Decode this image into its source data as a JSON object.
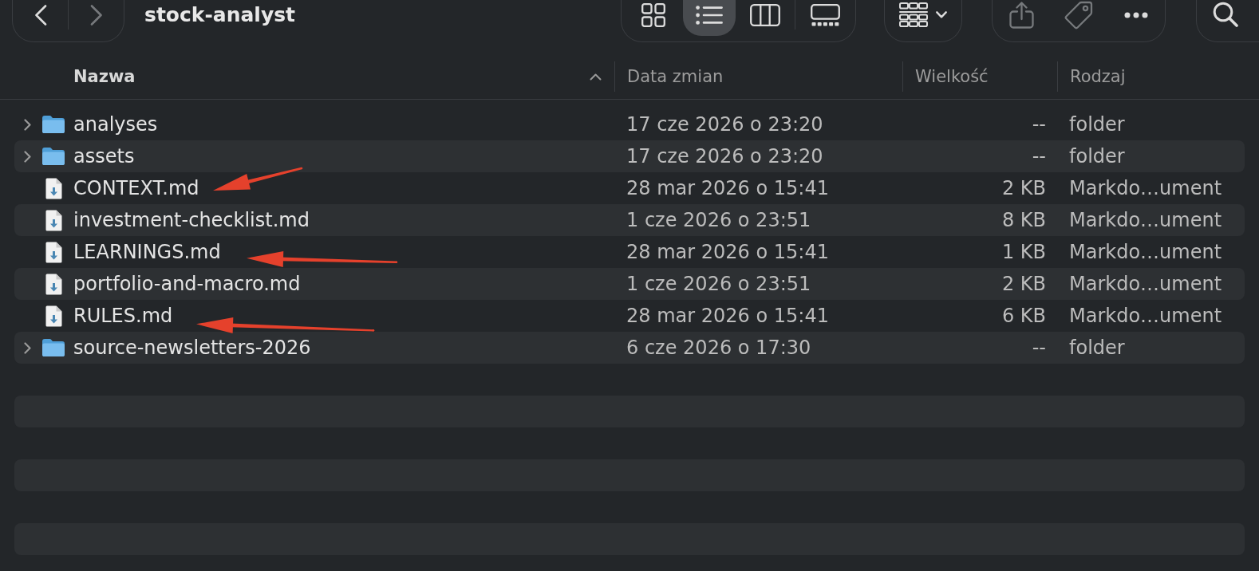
{
  "toolbar": {
    "back": {
      "disabled": false
    },
    "forward": {
      "disabled": true
    },
    "title": "stock-analyst",
    "view_modes": [
      {
        "kind": "icons",
        "selected": false
      },
      {
        "kind": "list",
        "selected": true
      },
      {
        "kind": "columns",
        "selected": false
      },
      {
        "kind": "gallery",
        "selected": false
      }
    ],
    "actions": [
      {
        "kind": "share",
        "disabled": true
      },
      {
        "kind": "tag",
        "disabled": true
      },
      {
        "kind": "more",
        "disabled": false
      }
    ]
  },
  "table": {
    "columns": [
      {
        "label": "Nazwa",
        "sorted": true
      },
      {
        "label": "Data zmian",
        "sorted": false
      },
      {
        "label": "Wielkość",
        "sorted": false
      },
      {
        "label": "Rodzaj",
        "sorted": false
      }
    ],
    "rows": [
      {
        "kind": "folder",
        "expanded": false,
        "name": "analyses",
        "modified": "17 cze 2026 o 23:20",
        "size": "--",
        "type": "folder",
        "annotated": false
      },
      {
        "kind": "folder",
        "expanded": false,
        "name": "assets",
        "modified": "17 cze 2026 o 23:20",
        "size": "--",
        "type": "folder",
        "annotated": false
      },
      {
        "kind": "document",
        "name": "CONTEXT.md",
        "modified": "28 mar 2026 o 15:41",
        "size": "2 KB",
        "type": "Markdo…ument",
        "annotated": true
      },
      {
        "kind": "document",
        "name": "investment-checklist.md",
        "modified": "1 cze 2026 o 23:51",
        "size": "8 KB",
        "type": "Markdo…ument",
        "annotated": false
      },
      {
        "kind": "document",
        "name": "LEARNINGS.md",
        "modified": "28 mar 2026 o 15:41",
        "size": "1 KB",
        "type": "Markdo…ument",
        "annotated": true
      },
      {
        "kind": "document",
        "name": "portfolio-and-macro.md",
        "modified": "1 cze 2026 o 23:51",
        "size": "2 KB",
        "type": "Markdo…ument",
        "annotated": false
      },
      {
        "kind": "document",
        "name": "RULES.md",
        "modified": "28 mar 2026 o 15:41",
        "size": "6 KB",
        "type": "Markdo…ument",
        "annotated": true
      },
      {
        "kind": "folder",
        "expanded": false,
        "name": "source-newsletters-2026",
        "modified": "6 cze 2026 o 17:30",
        "size": "--",
        "type": "folder",
        "annotated": false
      }
    ]
  }
}
